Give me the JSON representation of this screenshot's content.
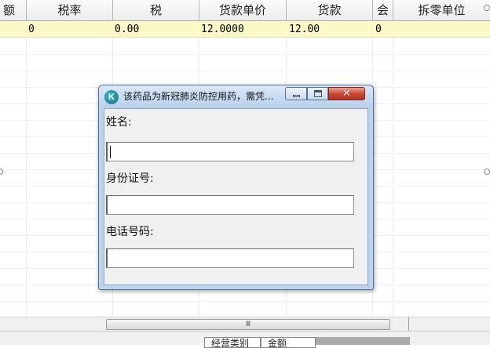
{
  "grid": {
    "columns": [
      "额",
      "税率",
      "税",
      "货款单价",
      "货款",
      "会",
      "拆零单位"
    ],
    "row": {
      "tax_rate": "0",
      "tax": "0.00",
      "unit_price": "12.0000",
      "payment": "12.00",
      "hui": "0"
    },
    "row_color": "#fcf9c9"
  },
  "dialog": {
    "title": "该药品为新冠肺炎防控用药，需凭...",
    "icon_letter": "K",
    "icon": "app-k-logo-icon",
    "fields": [
      {
        "label": "姓名:",
        "value": ""
      },
      {
        "label": "身份证号:",
        "value": ""
      },
      {
        "label": "电话号码:",
        "value": ""
      }
    ]
  },
  "scrollbar": {
    "grip": "Ⅲ"
  },
  "status": {
    "business_type": "经营类别",
    "amount": "金额"
  }
}
